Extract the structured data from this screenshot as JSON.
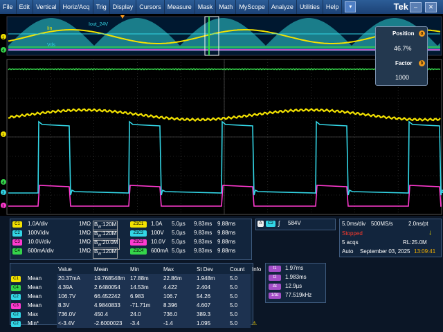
{
  "menu": [
    "File",
    "Edit",
    "Vertical",
    "Horiz/Acq",
    "Trig",
    "Display",
    "Cursors",
    "Measure",
    "Mask",
    "Math",
    "MyScope",
    "Analyze",
    "Utilities",
    "Help"
  ],
  "menu_drop_icon": "chevron-down-icon",
  "brand": "Tek",
  "window": {
    "minimize": "–",
    "close": "✕"
  },
  "waveform_labels": {
    "iout": "Iout_24V",
    "in": "Iin",
    "vds": "Vds"
  },
  "zoom": {
    "position_label": "Position",
    "position_key": "a",
    "position_value": "46.7%",
    "factor_label": "Factor",
    "factor_key": "b",
    "factor_value": "1000"
  },
  "channels": [
    {
      "ch": "C1",
      "color": "#f3e200",
      "scale": "1.0A/div",
      "imp": "1MΩ",
      "bw": "120M"
    },
    {
      "ch": "C2",
      "color": "#33d6e6",
      "scale": "100V/div",
      "imp": "1MΩ",
      "bw": "120M"
    },
    {
      "ch": "C3",
      "color": "#ff3ad0",
      "scale": "10.0V/div",
      "imp": "1MΩ",
      "bw": "20.0M"
    },
    {
      "ch": "C4",
      "color": "#35d44a",
      "scale": "600mA/div",
      "imp": "1MΩ",
      "bw": "120M"
    }
  ],
  "bw_prefix": "B",
  "bw_sub": "W",
  "zooms": [
    {
      "z": "Z1C1",
      "color": "#f3e200",
      "scale": "1.0A",
      "t": "5.0µs",
      "a": "9.83ms",
      "b": "9.88ms"
    },
    {
      "z": "Z1C2",
      "color": "#33d6e6",
      "scale": "100V",
      "t": "5.0µs",
      "a": "9.83ms",
      "b": "9.88ms"
    },
    {
      "z": "Z1C3",
      "color": "#ff3ad0",
      "scale": "10.0V",
      "t": "5.0µs",
      "a": "9.83ms",
      "b": "9.88ms"
    },
    {
      "z": "Z1C4",
      "color": "#35d44a",
      "scale": "600mA",
      "t": "5.0µs",
      "a": "9.83ms",
      "b": "9.88ms"
    }
  ],
  "trigger": {
    "mode": "A",
    "source": "C2",
    "slope": "∫",
    "level": "584V"
  },
  "acq": {
    "timebase": "5.0ms/div",
    "rate": "500MS/s",
    "res": "2.0ns/pt",
    "state": "Stopped",
    "acqs": "5 acqs",
    "rl": "RL:25.0M",
    "mode": "Auto",
    "date": "September 03, 2025",
    "time": "13:09:41"
  },
  "meas_headers": [
    "",
    "",
    "Value",
    "Mean",
    "Min",
    "Max",
    "St Dev",
    "Count",
    "Info"
  ],
  "meas_rows": [
    {
      "ch": "C1",
      "color": "#f3e200",
      "type": "Mean",
      "value": "20.37mA",
      "mean": "19.768548m",
      "min": "17.88m",
      "max": "22.86m",
      "sd": "1.948m",
      "count": "5.0",
      "info": ""
    },
    {
      "ch": "C4",
      "color": "#35d44a",
      "type": "Mean",
      "value": "4.39A",
      "mean": "2.6480054",
      "min": "14.53m",
      "max": "4.422",
      "sd": "2.404",
      "count": "5.0",
      "info": ""
    },
    {
      "ch": "C2",
      "color": "#33d6e6",
      "type": "Mean",
      "value": "106.7V",
      "mean": "66.452242",
      "min": "6.983",
      "max": "106.7",
      "sd": "54.26",
      "count": "5.0",
      "info": ""
    },
    {
      "ch": "C3",
      "color": "#ff3ad0",
      "type": "Mean",
      "value": "8.3V",
      "mean": "4.9840833",
      "min": "-71.71m",
      "max": "8.396",
      "sd": "4.607",
      "count": "5.0",
      "info": ""
    },
    {
      "ch": "C2",
      "color": "#33d6e6",
      "type": "Max",
      "value": "736.0V",
      "mean": "450.4",
      "min": "24.0",
      "max": "736.0",
      "sd": "389.3",
      "count": "5.0",
      "info": ""
    },
    {
      "ch": "C2",
      "color": "#33d6e6",
      "type": "Min*",
      "value": "<-3.4V",
      "mean": "-2.6000023",
      "min": "-3.4",
      "max": "-1.4",
      "sd": "1.095",
      "count": "5.0",
      "info": "warning-icon"
    }
  ],
  "cursors": [
    {
      "k": "t1",
      "v": "1.97ms"
    },
    {
      "k": "t2",
      "v": "1.983ms"
    },
    {
      "k": "Δt",
      "v": "12.9µs"
    },
    {
      "k": "1/Δt",
      "v": "77.519kHz"
    }
  ]
}
